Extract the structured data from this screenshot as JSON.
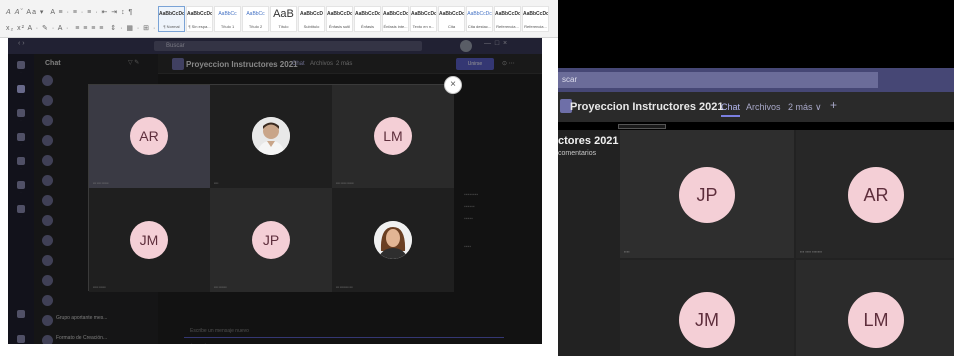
{
  "left": {
    "ribbon": {
      "styles": [
        {
          "sample": "AaBbCcDc",
          "name": "¶ Normal"
        },
        {
          "sample": "AaBbCcDc",
          "name": "¶ Sin espa..."
        },
        {
          "sample": "AaBbCc",
          "name": "Título 1"
        },
        {
          "sample": "AaBbCc",
          "name": "Título 2"
        },
        {
          "sample": "AaB",
          "name": "Título"
        },
        {
          "sample": "AaBbCcD",
          "name": "Subtítulo"
        },
        {
          "sample": "AaBbCcDc",
          "name": "Énfasis sutil"
        },
        {
          "sample": "AaBbCcDc",
          "name": "Énfasis"
        },
        {
          "sample": "AaBbCcDc",
          "name": "Énfasis inte..."
        },
        {
          "sample": "AaBbCcDc",
          "name": "Texto en n..."
        },
        {
          "sample": "AaBbCcDc",
          "name": "Cita"
        },
        {
          "sample": "AaBbCcDc",
          "name": "Cita destac..."
        },
        {
          "sample": "AaBbCcDc",
          "name": "Referencia..."
        },
        {
          "sample": "AaBbCcDc",
          "name": "Referencia..."
        }
      ]
    },
    "teams": {
      "search_text": "Buscar",
      "chat_header": "Chat",
      "chats": [
        {
          "name": "",
          "sub": ""
        },
        {
          "name": "",
          "sub": ""
        },
        {
          "name": "",
          "sub": ""
        },
        {
          "name": "",
          "sub": ""
        },
        {
          "name": "",
          "sub": ""
        },
        {
          "name": "",
          "sub": ""
        },
        {
          "name": "",
          "sub": ""
        },
        {
          "name": "",
          "sub": ""
        },
        {
          "name": "",
          "sub": ""
        },
        {
          "name": "",
          "sub": ""
        },
        {
          "name": "",
          "sub": ""
        },
        {
          "name": "",
          "sub": ""
        },
        {
          "name": "Grupo aportante mes...",
          "sub": ""
        },
        {
          "name": "Formato de Creación...",
          "sub": ""
        }
      ],
      "main_title": "Proyeccion Instructores 2021",
      "tabs": [
        "Chat",
        "Archivos",
        "2 más"
      ],
      "join_label": "Unirse",
      "compose_placeholder": "Escribe un mensaje nuevo"
    },
    "meeting": {
      "participants": [
        {
          "initials": "AR",
          "kind": "initials"
        },
        {
          "initials": "",
          "kind": "photo-man"
        },
        {
          "initials": "LM",
          "kind": "initials"
        },
        {
          "initials": "JM",
          "kind": "initials"
        },
        {
          "initials": "JP",
          "kind": "initials"
        },
        {
          "initials": "",
          "kind": "photo-woman"
        }
      ],
      "close_label": "×"
    }
  },
  "right": {
    "search_text": "scar",
    "title": "Proyeccion Instructores 2021",
    "tabs": {
      "chat": "Chat",
      "files": "Archivos",
      "more": "2 más ∨",
      "add": "+"
    },
    "meeting_title": "ctores 2021",
    "meeting_sub": "comentarios",
    "participants": [
      "JP",
      "AR",
      "JM",
      "LM"
    ]
  }
}
